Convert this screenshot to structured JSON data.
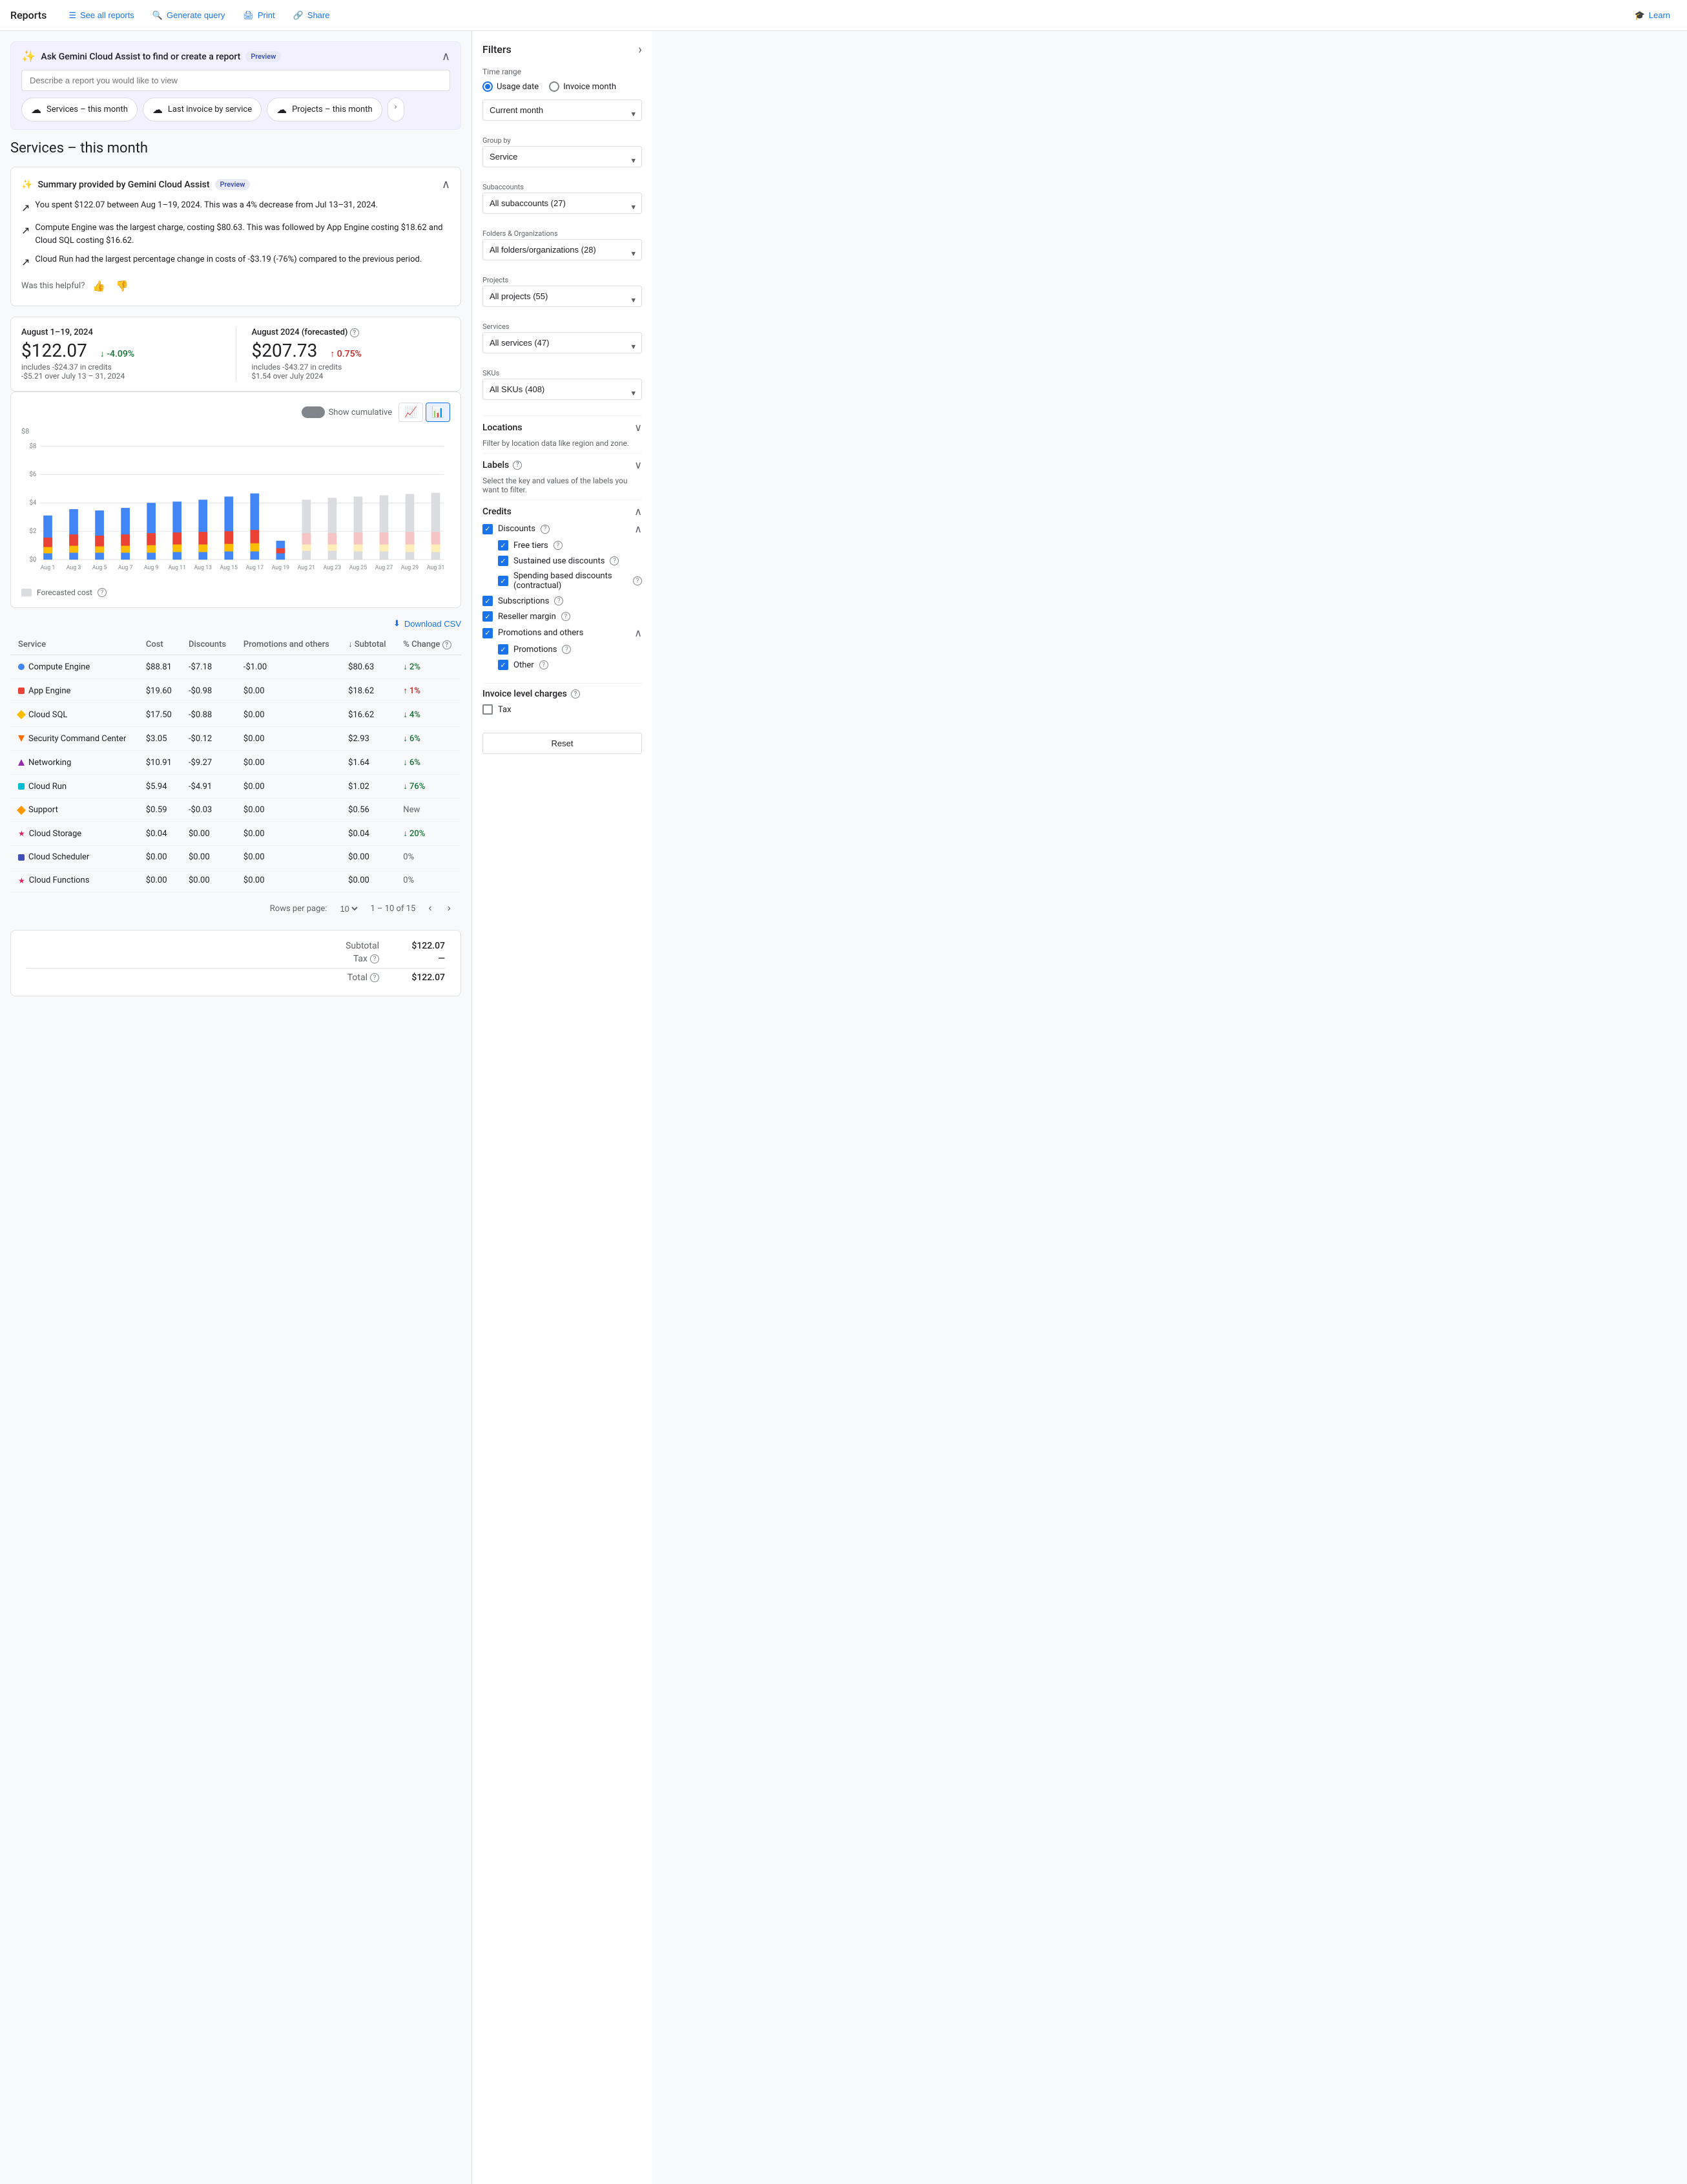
{
  "nav": {
    "title": "Reports",
    "see_all_reports": "See all reports",
    "generate_query": "Generate query",
    "print": "Print",
    "share": "Share",
    "learn": "Learn"
  },
  "gemini": {
    "title": "Ask Gemini Cloud Assist to find or create a report",
    "preview": "Preview",
    "input_placeholder": "Describe a report you would like to view",
    "chips": [
      {
        "label": "Services – this month",
        "color": "#4285f4"
      },
      {
        "label": "Last invoice by service",
        "color": "#ea4335"
      },
      {
        "label": "Projects – this month",
        "color": "#34a853"
      }
    ]
  },
  "page": {
    "title": "Services – this month"
  },
  "summary": {
    "title": "Summary provided by Gemini Cloud Assist",
    "preview": "Preview",
    "bullets": [
      "You spent $122.07 between Aug 1–19, 2024. This was a 4% decrease from Jul 13–31, 2024.",
      "Compute Engine was the largest charge, costing $80.63. This was followed by App Engine costing $18.62 and Cloud SQL costing $16.62.",
      "Cloud Run had the largest percentage change in costs of -$3.19 (-76%) compared to the previous period."
    ],
    "helpful_label": "Was this helpful?"
  },
  "metrics": {
    "current": {
      "period": "August 1–19, 2024",
      "amount": "$122.07",
      "credits": "includes -$24.37 in credits",
      "change_pct": "-4.09%",
      "change_desc": "-$5.21 over July 13 – 31, 2024",
      "change_dir": "down"
    },
    "forecasted": {
      "period": "August 2024 (forecasted)",
      "amount": "$207.73",
      "credits": "includes -$43.27 in credits",
      "change_pct": "0.75%",
      "change_desc": "$1.54 over July 2024",
      "change_dir": "up"
    }
  },
  "chart": {
    "y_label": "$8",
    "show_cumulative": "Show cumulative",
    "x_labels": [
      "Aug 1",
      "Aug 3",
      "Aug 5",
      "Aug 7",
      "Aug 9",
      "Aug 11",
      "Aug 13",
      "Aug 15",
      "Aug 17",
      "Aug 19",
      "Aug 21",
      "Aug 23",
      "Aug 25",
      "Aug 27",
      "Aug 29",
      "Aug 31"
    ],
    "legend": "Forecasted cost"
  },
  "table": {
    "download_csv": "Download CSV",
    "columns": [
      "Service",
      "Cost",
      "Discounts",
      "Promotions and others",
      "Subtotal",
      "% Change"
    ],
    "rows": [
      {
        "service": "Compute Engine",
        "color": "#4285f4",
        "shape": "circle",
        "cost": "$88.81",
        "discounts": "-$7.18",
        "promotions": "-$1.00",
        "subtotal": "$80.63",
        "change": "2%",
        "change_dir": "down"
      },
      {
        "service": "App Engine",
        "color": "#ea4335",
        "shape": "square",
        "cost": "$19.60",
        "discounts": "-$0.98",
        "promotions": "$0.00",
        "subtotal": "$18.62",
        "change": "1%",
        "change_dir": "up"
      },
      {
        "service": "Cloud SQL",
        "color": "#fbbc04",
        "shape": "diamond",
        "cost": "$17.50",
        "discounts": "-$0.88",
        "promotions": "$0.00",
        "subtotal": "$16.62",
        "change": "4%",
        "change_dir": "down"
      },
      {
        "service": "Security Command Center",
        "color": "#ff6d00",
        "shape": "triangle-down",
        "cost": "$3.05",
        "discounts": "-$0.12",
        "promotions": "$0.00",
        "subtotal": "$2.93",
        "change": "6%",
        "change_dir": "down"
      },
      {
        "service": "Networking",
        "color": "#9c27b0",
        "shape": "triangle-up",
        "cost": "$10.91",
        "discounts": "-$9.27",
        "promotions": "$0.00",
        "subtotal": "$1.64",
        "change": "6%",
        "change_dir": "down"
      },
      {
        "service": "Cloud Run",
        "color": "#00bcd4",
        "shape": "square",
        "cost": "$5.94",
        "discounts": "-$4.91",
        "promotions": "$0.00",
        "subtotal": "$1.02",
        "change": "76%",
        "change_dir": "down"
      },
      {
        "service": "Support",
        "color": "#ff9800",
        "shape": "diamond",
        "cost": "$0.59",
        "discounts": "-$0.03",
        "promotions": "$0.00",
        "subtotal": "$0.56",
        "change": "New",
        "change_dir": "neutral"
      },
      {
        "service": "Cloud Storage",
        "color": "#e91e63",
        "shape": "star",
        "cost": "$0.04",
        "discounts": "$0.00",
        "promotions": "$0.00",
        "subtotal": "$0.04",
        "change": "20%",
        "change_dir": "down"
      },
      {
        "service": "Cloud Scheduler",
        "color": "#3f51b5",
        "shape": "square",
        "cost": "$0.00",
        "discounts": "$0.00",
        "promotions": "$0.00",
        "subtotal": "$0.00",
        "change": "0%",
        "change_dir": "neutral"
      },
      {
        "service": "Cloud Functions",
        "color": "#e91e63",
        "shape": "star",
        "cost": "$0.00",
        "discounts": "$0.00",
        "promotions": "$0.00",
        "subtotal": "$0.00",
        "change": "0%",
        "change_dir": "neutral"
      }
    ],
    "pagination": {
      "rows_per_page": "10",
      "range": "1 – 10 of 15"
    }
  },
  "totals": {
    "subtotal_label": "Subtotal",
    "subtotal_value": "$122.07",
    "tax_label": "Tax",
    "tax_value": "—",
    "total_label": "Total",
    "total_value": "$122.07"
  },
  "filters": {
    "title": "Filters",
    "time_range_label": "Time range",
    "usage_date": "Usage date",
    "invoice_month": "Invoice month",
    "current_month": "Current month",
    "group_by_label": "Group by",
    "group_by_value": "Service",
    "subaccounts_label": "Subaccounts",
    "subaccounts_value": "All subaccounts (27)",
    "folders_label": "Folders & Organizations",
    "folders_value": "All folders/organizations (28)",
    "projects_label": "Projects",
    "projects_value": "All projects (55)",
    "services_label": "Services",
    "services_value": "All services (47)",
    "skus_label": "SKUs",
    "skus_value": "All SKUs (408)",
    "locations_label": "Locations",
    "locations_desc": "Filter by location data like region and zone.",
    "labels_label": "Labels",
    "labels_desc": "Select the key and values of the labels you want to filter.",
    "credits_label": "Credits",
    "discounts_label": "Discounts",
    "free_tiers_label": "Free tiers",
    "sustained_label": "Sustained use discounts",
    "spending_label": "Spending based discounts (contractual)",
    "subscriptions_label": "Subscriptions",
    "reseller_label": "Reseller margin",
    "promotions_label": "Promotions and others",
    "promotions_sub_label": "Promotions",
    "other_label": "Other",
    "invoice_charges_label": "Invoice level charges",
    "tax_label": "Tax",
    "reset_btn": "Reset"
  }
}
